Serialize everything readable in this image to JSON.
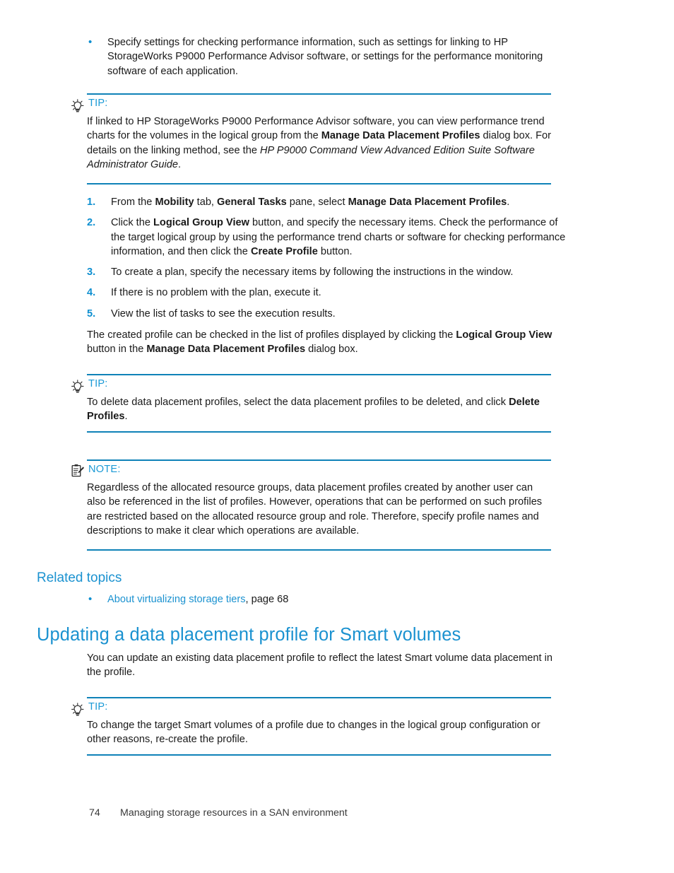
{
  "page": {
    "number": "74",
    "footer_title": "Managing storage resources in a SAN environment"
  },
  "colors": {
    "heading_blue": "#1b92d0",
    "rule_blue": "#0f82b8",
    "marker_blue": "#0e8fd0",
    "body_text": "#1a1a1a"
  },
  "top_bullets": [
    {
      "marker": "•",
      "text": "Specify settings for checking performance information, such as settings for linking to HP StorageWorks P9000 Performance Advisor software, or settings for the performance monitoring software of each application."
    }
  ],
  "tip_1": {
    "icon": "lightbulb-icon",
    "label": "TIP:",
    "segments": [
      {
        "text": "If linked to HP StorageWorks P9000 Performance Advisor software, you can view performance trend charts for the volumes in the logical group from the ",
        "style": "normal"
      },
      {
        "text": "Manage Data Placement Profiles",
        "style": "bold"
      },
      {
        "text": " dialog box. For details on the linking method, see the ",
        "style": "normal"
      },
      {
        "text": "HP P9000 Command View Advanced Edition Suite Software Administrator Guide",
        "style": "italic"
      },
      {
        "text": ".",
        "style": "normal"
      }
    ]
  },
  "steps": [
    {
      "marker": "1.",
      "segments": [
        {
          "text": "From the ",
          "style": "normal"
        },
        {
          "text": "Mobility",
          "style": "bold"
        },
        {
          "text": " tab, ",
          "style": "normal"
        },
        {
          "text": "General Tasks",
          "style": "bold"
        },
        {
          "text": " pane, select ",
          "style": "normal"
        },
        {
          "text": "Manage Data Placement Profiles",
          "style": "bold"
        },
        {
          "text": ".",
          "style": "normal"
        }
      ]
    },
    {
      "marker": "2.",
      "segments": [
        {
          "text": "Click the ",
          "style": "normal"
        },
        {
          "text": "Logical Group View",
          "style": "bold"
        },
        {
          "text": " button, and specify the necessary items. Check the performance of the target logical group by using the performance trend charts or software for checking performance information, and then click the ",
          "style": "normal"
        },
        {
          "text": "Create Profile",
          "style": "bold"
        },
        {
          "text": " button.",
          "style": "normal"
        }
      ]
    },
    {
      "marker": "3.",
      "segments": [
        {
          "text": "To create a plan, specify the necessary items by following the instructions in the window.",
          "style": "normal"
        }
      ]
    },
    {
      "marker": "4.",
      "segments": [
        {
          "text": "If there is no problem with the plan, execute it.",
          "style": "normal"
        }
      ]
    },
    {
      "marker": "5.",
      "segments": [
        {
          "text": "View the list of tasks to see the execution results.",
          "style": "normal"
        }
      ]
    }
  ],
  "para_after_steps": {
    "segments": [
      {
        "text": "The created profile can be checked in the list of profiles displayed by clicking the ",
        "style": "normal"
      },
      {
        "text": "Logical Group View",
        "style": "bold"
      },
      {
        "text": " button in the ",
        "style": "normal"
      },
      {
        "text": "Manage Data Placement Profiles",
        "style": "bold"
      },
      {
        "text": " dialog box.",
        "style": "normal"
      }
    ]
  },
  "tip_2": {
    "icon": "lightbulb-icon",
    "label": "TIP:",
    "segments": [
      {
        "text": "To delete data placement profiles, select the data placement profiles to be deleted, and click ",
        "style": "normal"
      },
      {
        "text": "Delete Profiles",
        "style": "bold"
      },
      {
        "text": ".",
        "style": "normal"
      }
    ]
  },
  "note_1": {
    "icon": "note-clipboard-icon",
    "label": "NOTE:",
    "segments": [
      {
        "text": "Regardless of the allocated resource groups, data placement profiles created by another user can also be referenced in the list of profiles. However, operations that can be performed on such profiles are restricted based on the allocated resource group and role. Therefore, specify profile names and descriptions to make it clear which operations are available.",
        "style": "normal"
      }
    ]
  },
  "related_topics": {
    "heading": "Related topics",
    "items": [
      {
        "marker": "•",
        "link_text": "About virtualizing storage tiers",
        "page_text": ", page 68"
      }
    ]
  },
  "section": {
    "heading": "Updating a data placement profile for Smart volumes",
    "intro": "You can update an existing data placement profile to reflect the latest Smart volume data placement in the profile."
  },
  "tip_3": {
    "icon": "lightbulb-icon",
    "label": "TIP:",
    "segments": [
      {
        "text": "To change the target Smart volumes of a profile due to changes in the logical group configuration or other reasons, re-create the profile.",
        "style": "normal"
      }
    ]
  }
}
